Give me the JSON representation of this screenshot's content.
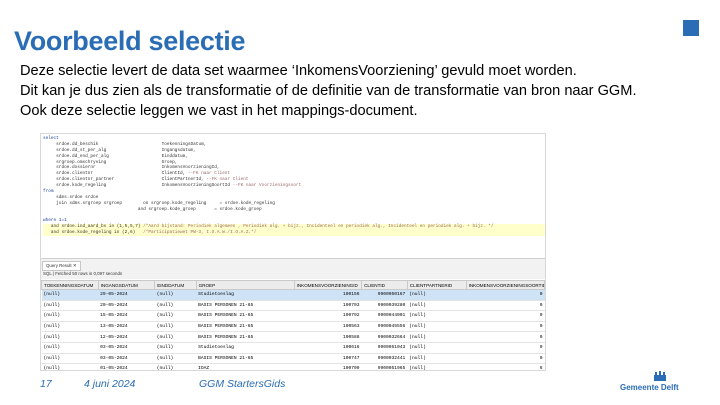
{
  "slide": {
    "title": "Voorbeeld selectie",
    "lines": [
      "Deze selectie levert de data set waarmee ‘InkomensVoorziening’ gevuld moet worden.",
      "Dit kan je dus zien als de transformatie of de definitie van de transformatie van bron naar GGM.",
      "Ook deze selectie leggen we vast in het mappings-document."
    ]
  },
  "sql_editor": {
    "lines": [
      {
        "code": "select",
        "comment": ""
      },
      {
        "code": "     srdoe.dd_beschik                        ToekenningsDatum,",
        "comment": ""
      },
      {
        "code": "     srdoe.dd_st_per_alg                     Ingangsdatum,",
        "comment": ""
      },
      {
        "code": "     srdoe.dd_end_per_alg                    Einddatum,",
        "comment": ""
      },
      {
        "code": "     srgroep.omschryving                     Groep,",
        "comment": ""
      },
      {
        "code": "     srdoe.dossiernr                         InkomensVoorzieningId,",
        "comment": ""
      },
      {
        "code": "     srdoe.clientnr                          ClientId,",
        "comment": " --FK naar Client"
      },
      {
        "code": "     srdoe.clientnr_partner                  ClientPartnerId,",
        "comment": " --FK naar Client"
      },
      {
        "code": "     srdoe.kode_regeling                     InkomensVoorzieningSoortId",
        "comment": " --FK naar Voorzieningsoort"
      },
      {
        "code": "from",
        "comment": ""
      },
      {
        "code": "     sdms.srdoe srdoe",
        "comment": ""
      },
      {
        "code": "     join sdms.srgroep srgroep        on srgroep.kode_regeling     = srdoe.kode_regeling",
        "comment": ""
      },
      {
        "code": "                                    and srgroep.kode_groep       = srdoe.kode_groep",
        "comment": ""
      },
      {
        "code": "",
        "comment": ""
      },
      {
        "code": "where 1=1",
        "comment": ""
      },
      {
        "code": "   and srdoe.ind_aard_bs in (1,5,5,7)",
        "comment": " /*Aard bijstand: Periodiek algemeen , Periodiek alg. + bijz., Incidenteel en periodiek alg., Incidenteel en periodiek alg. + bijz. */"
      },
      {
        "code": "   and srdoe.kode_regeling in (2,6)",
        "comment": "   /*Participatiewet PW-3, I.O.A.W./I.O.A.Z.*/"
      }
    ]
  },
  "results": {
    "tab_label": "Query Result ✕",
    "status": "SQL | Fetched 50 rows in 0,097 seconds",
    "columns": [
      "TOEKENNINGSDATUM",
      "INGANGSDATUM",
      "EINDDATUM",
      "GROEP",
      "INKOMENSVOORZIENINGID",
      "CLIENTID",
      "CLIENTPARTNERID",
      "INKOMENSVOORZIENINGSOORTID"
    ],
    "rows": [
      [
        "(null)",
        "29-05-2024",
        "(null)",
        "Studietoeslag",
        "100156",
        "9900050167",
        "(null)",
        "0"
      ],
      [
        "(null)",
        "20-05-2024",
        "(null)",
        "BASIS PERSONEN 21-65",
        "100703",
        "9900039280",
        "(null)",
        "0"
      ],
      [
        "(null)",
        "15-05-2024",
        "(null)",
        "BASIS PERSONEN 21-65",
        "100792",
        "9900044001",
        "(null)",
        "0"
      ],
      [
        "(null)",
        "13-05-2024",
        "(null)",
        "BASIS PERSONEN 21-65",
        "100563",
        "9900045556",
        "(null)",
        "0"
      ],
      [
        "(null)",
        "12-05-2024",
        "(null)",
        "BASIS PERSONEN 21-65",
        "100588",
        "9900032664",
        "(null)",
        "0"
      ],
      [
        "(null)",
        "03-05-2024",
        "(null)",
        "Studietoeslag",
        "100616",
        "9900051043",
        "(null)",
        "0"
      ],
      [
        "(null)",
        "03-05-2024",
        "(null)",
        "BASIS PERSONEN 21-65",
        "100747",
        "9900032441",
        "(null)",
        "0"
      ],
      [
        "(null)",
        "01-05-2024",
        "(null)",
        "IOAZ",
        "100709",
        "9900051965",
        "(null)",
        "6"
      ],
      [
        "(null)",
        "01-05-2024",
        "(null)",
        "BASIS PERSONEN 21-65",
        "100697",
        "9900027441",
        "(null)",
        "0"
      ]
    ]
  },
  "footer": {
    "page_number": "17",
    "date": "4 juni 2024",
    "title": "GGM StartersGids",
    "logo_text": "Gemeente Delft"
  }
}
